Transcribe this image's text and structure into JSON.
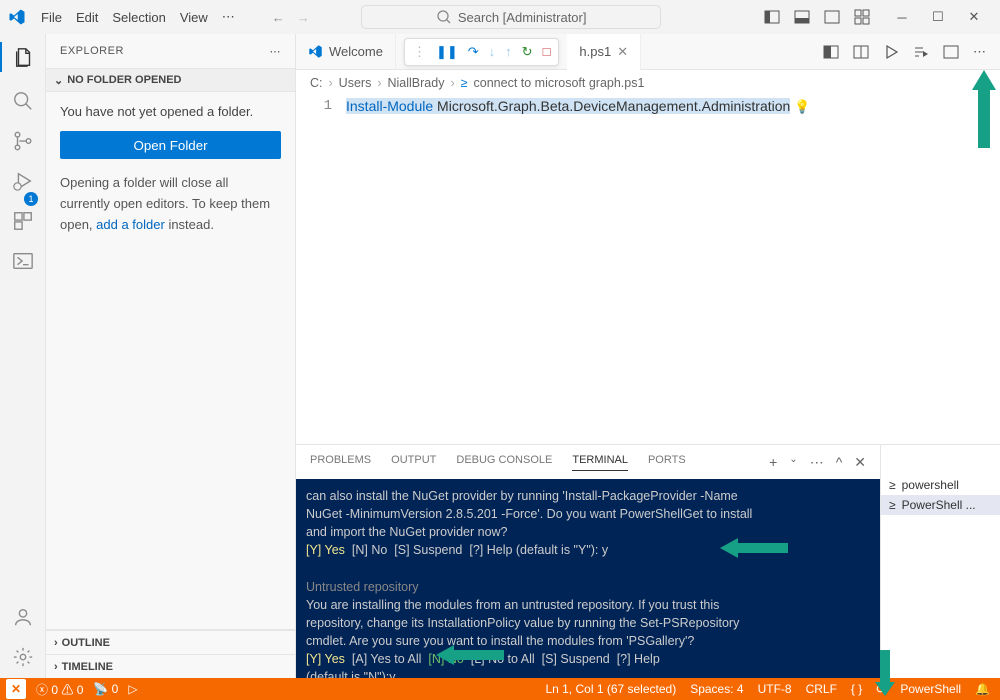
{
  "menu": {
    "file": "File",
    "edit": "Edit",
    "selection": "Selection",
    "view": "View"
  },
  "search": {
    "placeholder": "Search [Administrator]"
  },
  "sidebar": {
    "title": "EXPLORER",
    "section": "NO FOLDER OPENED",
    "msg1": "You have not yet opened a folder.",
    "openBtn": "Open Folder",
    "hint1": "Opening a folder will close all currently open editors. To keep them open, ",
    "hintLink": "add a folder",
    "hint2": " instead.",
    "outline": "OUTLINE",
    "timeline": "TIMELINE",
    "badge": "1"
  },
  "tabs": {
    "welcome": "Welcome",
    "file": "h.ps1"
  },
  "breadcrumb": {
    "c": "C:",
    "users": "Users",
    "user": "NiallBrady",
    "file": "connect to microsoft graph.ps1"
  },
  "code": {
    "line": "1",
    "kw": "Install-Module",
    "rest": " Microsoft.Graph.Beta.DeviceManagement.Administration"
  },
  "panel": {
    "problems": "PROBLEMS",
    "output": "OUTPUT",
    "debug": "DEBUG CONSOLE",
    "terminal": "TERMINAL",
    "ports": "PORTS",
    "term1": "powershell",
    "term2": "PowerShell ..."
  },
  "terminal": {
    "l1": "can also install the NuGet provider by running 'Install-PackageProvider -Name",
    "l2": "NuGet -MinimumVersion 2.8.5.201 -Force'. Do you want PowerShellGet to install",
    "l3": "and import the NuGet provider now?",
    "p1a": "[Y] Yes",
    "p1b": "[N] No",
    "p1c": "[S] Suspend",
    "p1d": "[?] Help (default is \"Y\"): y",
    "l5": "Untrusted repository",
    "l6": "You are installing the modules from an untrusted repository. If you trust this",
    "l7": "repository, change its InstallationPolicy value by running the Set-PSRepository",
    "l8": " cmdlet. Are you sure you want to install the modules from 'PSGallery'?",
    "p2a": "[Y] Yes",
    "p2b": "[A] Yes to All",
    "p2c": "[N] No",
    "p2d": "[L] No to All",
    "p2e": "[S] Suspend",
    "p2f": "[?] Help",
    "l10": "(default is \"N\"):y"
  },
  "status": {
    "errors": "0",
    "warnings": "0",
    "radio": "0",
    "ln": "Ln 1, Col 1 (67 selected)",
    "spaces": "Spaces: 4",
    "enc": "UTF-8",
    "eol": "CRLF",
    "braces": "{ }",
    "lang": "PowerShell"
  }
}
